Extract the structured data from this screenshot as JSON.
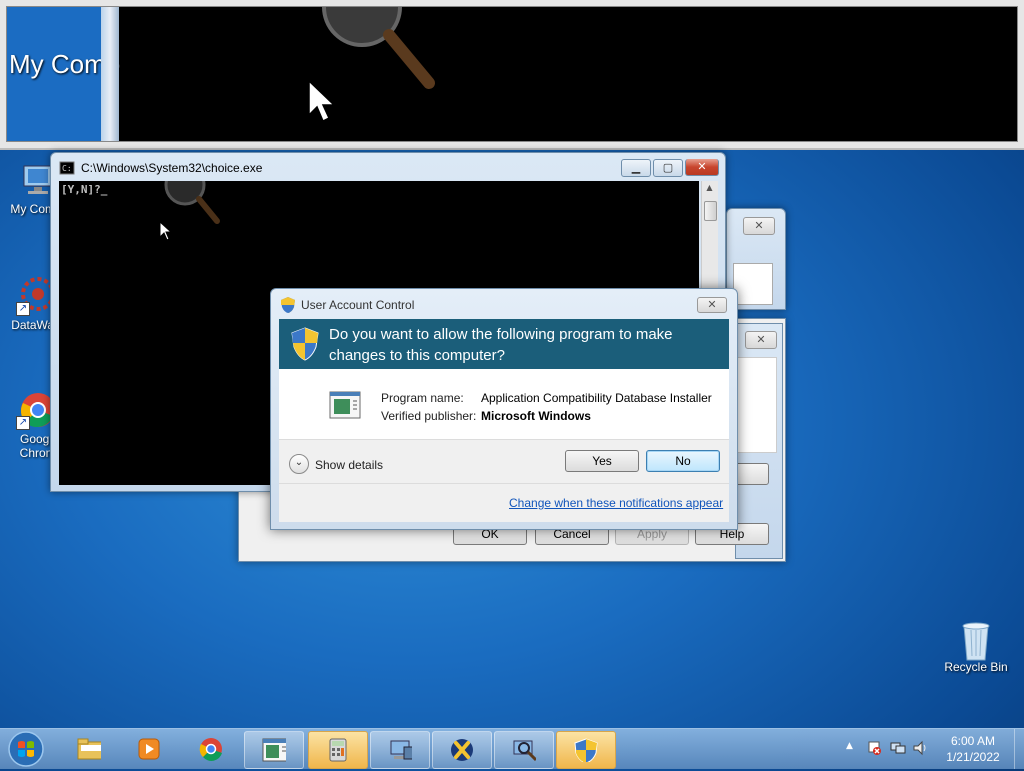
{
  "magnifier": {
    "desktop_text": "My Comp",
    "console_text": "[Y,N]?_"
  },
  "desktop_icons": [
    {
      "label": "My Comp"
    },
    {
      "label": "DataWag"
    },
    {
      "label": "Googl Chron"
    },
    {
      "label": "Recycle Bin"
    }
  ],
  "console_window": {
    "title": "C:\\Windows\\System32\\choice.exe",
    "prompt_text": "[Y,N]?",
    "cursor": "_"
  },
  "back_dialog": {
    "buttons": [
      {
        "label": "OK",
        "enabled": true
      },
      {
        "label": "Cancel",
        "enabled": true
      },
      {
        "label": "Apply",
        "enabled": false
      },
      {
        "label": "Help",
        "enabled": true
      }
    ]
  },
  "uac": {
    "title": "User Account Control",
    "question": "Do you want to allow the following program to make changes to this computer?",
    "program_label": "Program name:",
    "program_value": "Application Compatibility Database Installer",
    "publisher_label": "Verified publisher:",
    "publisher_value": "Microsoft Windows",
    "details_label": "Show details",
    "yes_label": "Yes",
    "no_label": "No",
    "link_text": "Change when these notifications appear",
    "header_color": "#1b5e7a"
  },
  "taskbar": {
    "items": [
      {
        "icon": "folder-icon"
      },
      {
        "icon": "media-player-icon"
      },
      {
        "icon": "chrome-icon"
      },
      {
        "icon": "app-installer-icon"
      },
      {
        "icon": "calculator-icon"
      },
      {
        "icon": "network-computer-icon"
      },
      {
        "icon": "xbox-x-icon"
      },
      {
        "icon": "search-computer-icon"
      },
      {
        "icon": "uac-shield-icon"
      }
    ],
    "time": "6:00 AM",
    "date": "1/21/2022"
  }
}
